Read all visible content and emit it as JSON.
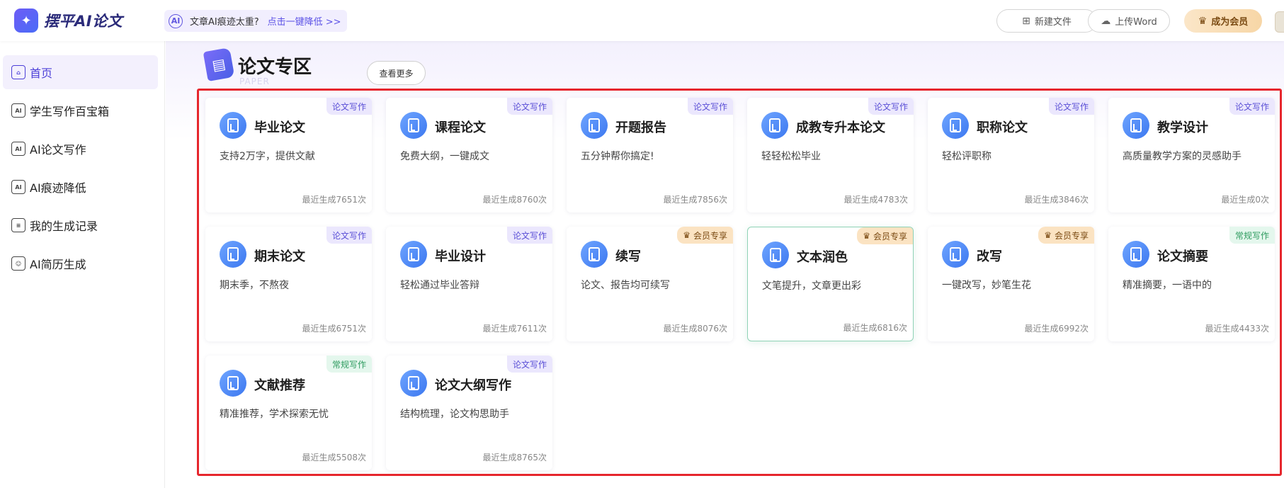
{
  "header": {
    "logo_mark": "✦",
    "logo_text": "摆平AI论文",
    "notice_icon": "AI",
    "notice_text": "文章AI痕迹太重?",
    "notice_link": "点击一键降低 >>",
    "new_file": "新建文件",
    "upload_word": "上传Word",
    "become_vip": "成为会员"
  },
  "sidebar": {
    "items": [
      {
        "label": "首页",
        "icon": "home-icon",
        "glyph": "⌂"
      },
      {
        "label": "学生写作百宝箱",
        "icon": "ai-box-icon",
        "glyph": "AI"
      },
      {
        "label": "AI论文写作",
        "icon": "ai-paper-icon",
        "glyph": "AI"
      },
      {
        "label": "AI痕迹降低",
        "icon": "ai-reduce-icon",
        "glyph": "AI"
      },
      {
        "label": "我的生成记录",
        "icon": "history-icon",
        "glyph": "≡"
      },
      {
        "label": "AI简历生成",
        "icon": "resume-icon",
        "glyph": "☺"
      }
    ]
  },
  "section": {
    "title": "论文专区",
    "subtitle": "PAPER",
    "more": "查看更多"
  },
  "cards": [
    {
      "title": "毕业论文",
      "desc": "支持2万字，提供文献",
      "count": "最近生成7651次",
      "tag": "论文写作",
      "tag_style": "purple"
    },
    {
      "title": "课程论文",
      "desc": "免费大纲，一键成文",
      "count": "最近生成8760次",
      "tag": "论文写作",
      "tag_style": "purple"
    },
    {
      "title": "开题报告",
      "desc": "五分钟帮你搞定!",
      "count": "最近生成7856次",
      "tag": "论文写作",
      "tag_style": "purple"
    },
    {
      "title": "成教专升本论文",
      "desc": "轻轻松松毕业",
      "count": "最近生成4783次",
      "tag": "论文写作",
      "tag_style": "purple"
    },
    {
      "title": "职称论文",
      "desc": "轻松评职称",
      "count": "最近生成3846次",
      "tag": "论文写作",
      "tag_style": "purple"
    },
    {
      "title": "教学设计",
      "desc": "高质量教学方案的灵感助手",
      "count": "最近生成0次",
      "tag": "论文写作",
      "tag_style": "purple"
    },
    {
      "title": "期末论文",
      "desc": "期末季，不熬夜",
      "count": "最近生成6751次",
      "tag": "论文写作",
      "tag_style": "purple"
    },
    {
      "title": "毕业设计",
      "desc": "轻松通过毕业答辩",
      "count": "最近生成7611次",
      "tag": "论文写作",
      "tag_style": "purple"
    },
    {
      "title": "续写",
      "desc": "论文、报告均可续写",
      "count": "最近生成8076次",
      "tag": "会员专享",
      "tag_style": "gold"
    },
    {
      "title": "文本润色",
      "desc": "文笔提升，文章更出彩",
      "count": "最近生成6816次",
      "tag": "会员专享",
      "tag_style": "gold"
    },
    {
      "title": "改写",
      "desc": "一键改写，妙笔生花",
      "count": "最近生成6992次",
      "tag": "会员专享",
      "tag_style": "gold"
    },
    {
      "title": "论文摘要",
      "desc": "精准摘要，一语中的",
      "count": "最近生成4433次",
      "tag": "常规写作",
      "tag_style": "green"
    },
    {
      "title": "文献推荐",
      "desc": "精准推荐，学术探索无忧",
      "count": "最近生成5508次",
      "tag": "常规写作",
      "tag_style": "green"
    },
    {
      "title": "论文大纲写作",
      "desc": "结构梳理，论文构思助手",
      "count": "最近生成8765次",
      "tag": "论文写作",
      "tag_style": "purple"
    }
  ],
  "colors": {
    "accent": "#5b51e6",
    "tag_purple": "#5a4fd6",
    "tag_green": "#2e9b5f",
    "tag_gold": "#7a4a12",
    "highlight_border": "#e6262d"
  }
}
